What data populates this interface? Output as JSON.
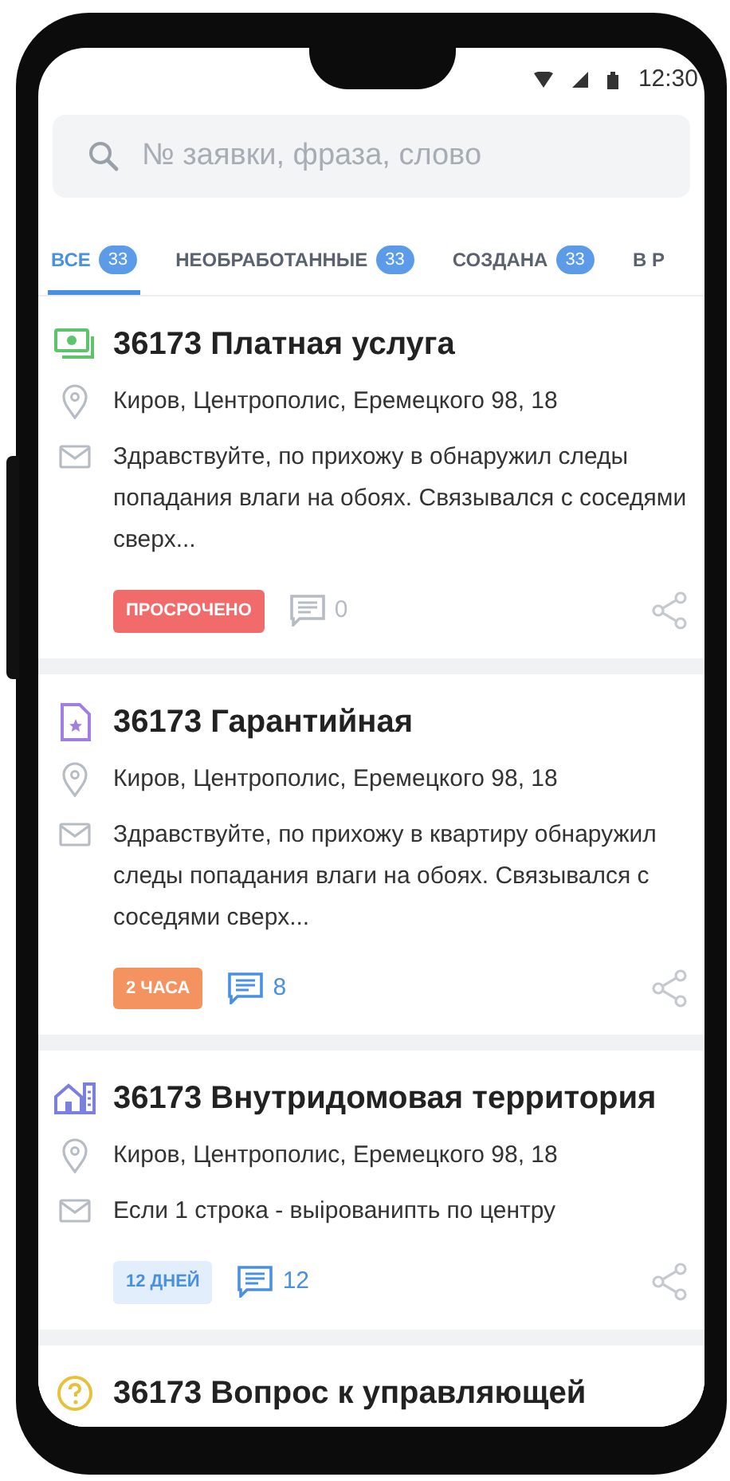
{
  "status_bar": {
    "time": "12:30"
  },
  "search": {
    "placeholder": "№ заявки, фраза, слово"
  },
  "tabs": [
    {
      "label": "ВСЕ",
      "count": "33",
      "selected": true
    },
    {
      "label": "НЕОБРАБОТАННЫЕ",
      "count": "33",
      "selected": false
    },
    {
      "label": "СОЗДАНА",
      "count": "33",
      "selected": false
    },
    {
      "label": "В Р",
      "selected": false
    }
  ],
  "requests": [
    {
      "kind": "paid",
      "title": "36173 Платная услуга",
      "address": "Киров,  Центрополис, Еремецкого 98, 18",
      "message": "Здравствуйте, по прихожу в обнаружил следы попадания влаги на обоях. Связывался с соседями сверх...",
      "badge": {
        "kind": "overdue",
        "text": "ПРОСРОЧЕНО"
      },
      "comments": {
        "count": "0",
        "unread": false
      }
    },
    {
      "kind": "warranty",
      "title": "36173 Гарантийная",
      "address": "Киров,  Центрополис, Еремецкого 98, 18",
      "message": "Здравствуйте, по прихожу в квартиру обнаружил следы попадания влаги на обоях. Связывался с соседями сверх...",
      "badge": {
        "kind": "hours",
        "text": "2 ЧАСА"
      },
      "comments": {
        "count": "8",
        "unread": true
      }
    },
    {
      "kind": "territory",
      "title": "36173 Внутридомовая территория",
      "address": "Киров,  Центрополис, Еремецкого 98, 18",
      "message": "Если 1 строка - выірованипть по центру",
      "badge": {
        "kind": "days",
        "text": "12 ДНЕЙ"
      },
      "comments": {
        "count": "12",
        "unread": true
      }
    },
    {
      "kind": "question",
      "title": "36173 Вопрос к управляющей"
    }
  ]
}
